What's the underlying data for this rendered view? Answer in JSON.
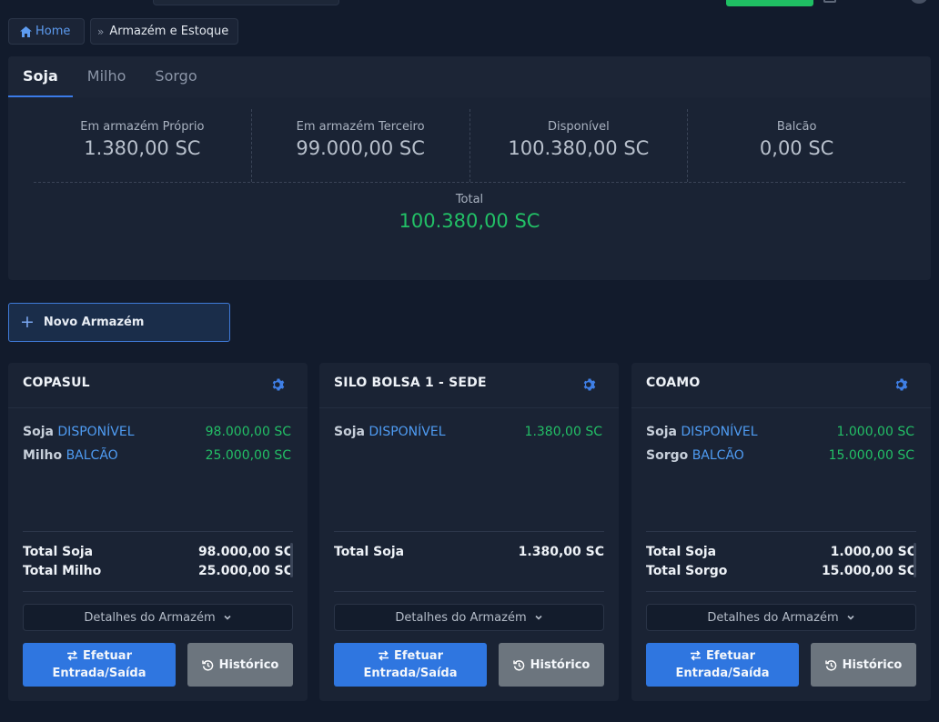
{
  "breadcrumb": {
    "home_label": "Home",
    "current": "Armazém e Estoque"
  },
  "tabs": [
    {
      "label": "Soja",
      "active": true
    },
    {
      "label": "Milho",
      "active": false
    },
    {
      "label": "Sorgo",
      "active": false
    }
  ],
  "summary": {
    "stats": [
      {
        "label": "Em armazém Próprio",
        "value": "1.380,00 SC"
      },
      {
        "label": "Em armazém Terceiro",
        "value": "99.000,00 SC"
      },
      {
        "label": "Disponível",
        "value": "100.380,00 SC"
      },
      {
        "label": "Balcão",
        "value": "0,00 SC"
      }
    ],
    "total_label": "Total",
    "total_value": "100.380,00 SC"
  },
  "new_warehouse_label": "Novo Armazém",
  "warehouses": [
    {
      "name": "COPASUL",
      "items": [
        {
          "product": "Soja",
          "status": "DISPONÍVEL",
          "value": "98.000,00 SC"
        },
        {
          "product": "Milho",
          "status": "BALCÃO",
          "value": "25.000,00 SC"
        }
      ],
      "totals": [
        {
          "label": "Total Soja",
          "value": "98.000,00 SC"
        },
        {
          "label": "Total Milho",
          "value": "25.000,00 SC"
        }
      ],
      "details_label": "Detalhes do Armazém",
      "move_label_1": "Efetuar",
      "move_label_2": "Entrada/Saída",
      "history_label": "Histórico"
    },
    {
      "name": "SILO BOLSA 1 - SEDE",
      "items": [
        {
          "product": "Soja",
          "status": "DISPONÍVEL",
          "value": "1.380,00 SC"
        }
      ],
      "totals": [
        {
          "label": "Total Soja",
          "value": "1.380,00 SC"
        }
      ],
      "details_label": "Detalhes do Armazém",
      "move_label_1": "Efetuar",
      "move_label_2": "Entrada/Saída",
      "history_label": "Histórico"
    },
    {
      "name": "COAMO",
      "items": [
        {
          "product": "Soja",
          "status": "DISPONÍVEL",
          "value": "1.000,00 SC"
        },
        {
          "product": "Sorgo",
          "status": "BALCÃO",
          "value": "15.000,00 SC"
        }
      ],
      "totals": [
        {
          "label": "Total Soja",
          "value": "1.000,00 SC"
        },
        {
          "label": "Total Sorgo",
          "value": "15.000,00 SC"
        }
      ],
      "details_label": "Detalhes do Armazém",
      "move_label_1": "Efetuar",
      "move_label_2": "Entrada/Saída",
      "history_label": "Histórico"
    }
  ],
  "colors": {
    "accent": "#3b7be8",
    "positive": "#23bf66",
    "status_link": "#4f9cf3",
    "history_button": "#6c757e"
  }
}
